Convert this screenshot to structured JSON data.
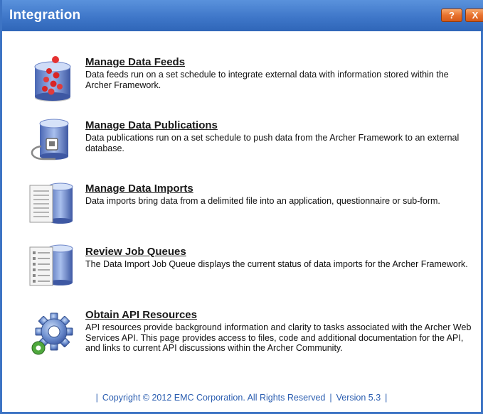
{
  "window": {
    "title": "Integration",
    "help_button_label": "?",
    "close_button_label": "X"
  },
  "items": [
    {
      "title": "Manage Data Feeds",
      "description": "Data feeds run on a set schedule to integrate external data with information stored within the Archer Framework.",
      "icon": "data-feeds-icon"
    },
    {
      "title": "Manage Data Publications",
      "description": "Data publications run on a set schedule to push data from the Archer Framework to an external database.",
      "icon": "data-publications-icon"
    },
    {
      "title": "Manage Data Imports",
      "description": "Data imports bring data from a delimited file into an application, questionnaire or sub-form.",
      "icon": "data-imports-icon"
    },
    {
      "title": "Review Job Queues",
      "description": "The Data Import Job Queue displays the current status of data imports for the Archer Framework.",
      "icon": "job-queues-icon"
    },
    {
      "title": "Obtain API Resources",
      "description": "API resources provide background information and clarity to tasks associated with the Archer Web Services API. This page provides access to files, code and additional documentation for the API, and links to current API discussions within the Archer Community.",
      "icon": "api-resources-icon"
    }
  ],
  "footer": {
    "separator": "|",
    "copyright": "Copyright © 2012 EMC Corporation.  All Rights Reserved",
    "version": "Version 5.3"
  },
  "colors": {
    "titlebar": "#3f77c9",
    "close_button": "#e8712d",
    "footer_text": "#2a5db0"
  }
}
